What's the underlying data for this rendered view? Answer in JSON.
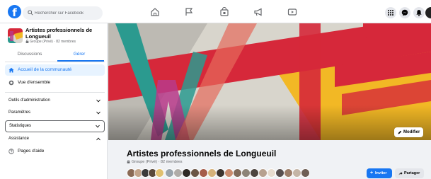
{
  "top_bar": {
    "logo_letter": "f",
    "search_placeholder": "Rechercher sur Facebook",
    "nav_icons": [
      "home-icon",
      "flag-icon",
      "marketplace-icon",
      "megaphone-icon",
      "watch-icon"
    ],
    "right_icons": [
      "menu-grid-icon",
      "messenger-icon",
      "notifications-icon",
      "account-avatar"
    ]
  },
  "sidebar": {
    "group_name": "Artistes professionnels de Longueuil",
    "group_meta": "Groupe (Privé) · 82 membres",
    "tabs": [
      {
        "label": "Discussions",
        "active": false
      },
      {
        "label": "Gérer",
        "active": true
      }
    ],
    "items": [
      {
        "label": "Accueil de la communauté",
        "icon": "home-icon",
        "active": true
      },
      {
        "label": "Vue d'ensemble",
        "icon": "overview-icon",
        "active": false
      }
    ],
    "sections": [
      {
        "label": "Outils d'administration",
        "chevron": "down"
      },
      {
        "label": "Paramètres",
        "chevron": "down"
      },
      {
        "label": "Statistiques",
        "chevron": "down"
      },
      {
        "label": "Assistance",
        "chevron": "up"
      }
    ],
    "help_item": {
      "label": "Pages d'aide",
      "icon": "help-icon"
    }
  },
  "cover": {
    "edit_label": "Modifier",
    "colors": {
      "red": "#d6283a",
      "yellow": "#f2b825",
      "teal": "#2b9a8f",
      "magenta": "#b83a8b",
      "gray": "#9a9a9a"
    }
  },
  "header": {
    "title": "Artistes professionnels de Longueuil",
    "meta": "Groupe (Privé) · 82 membres",
    "invite_label": "Inviter",
    "share_label": "Partager"
  },
  "colors": {
    "accent": "#1877f2",
    "accent_light": "#e7f3ff",
    "text_secondary": "#65676b"
  }
}
